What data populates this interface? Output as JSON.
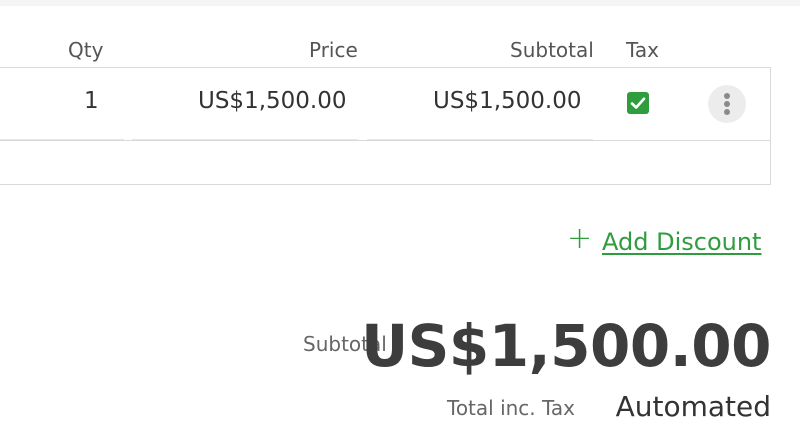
{
  "columns": {
    "qty": "Qty",
    "price": "Price",
    "subtotal": "Subtotal",
    "tax": "Tax"
  },
  "line_item": {
    "qty": "1",
    "price": "US$1,500.00",
    "subtotal": "US$1,500.00",
    "tax_checked": true
  },
  "actions": {
    "add_discount_icon": "+",
    "add_discount_label": "Add Discount"
  },
  "totals": {
    "subtotal_label": "Subtotal",
    "subtotal_value": "US$1,500.00",
    "total_label": "Total inc. Tax",
    "total_value": "Automated"
  },
  "colors": {
    "accent_green": "#2f9d3e",
    "border": "#d9d9d9"
  },
  "icons": {
    "tax": "checkbox-checked-icon",
    "row_menu": "more-vertical-icon",
    "add": "plus-icon"
  }
}
